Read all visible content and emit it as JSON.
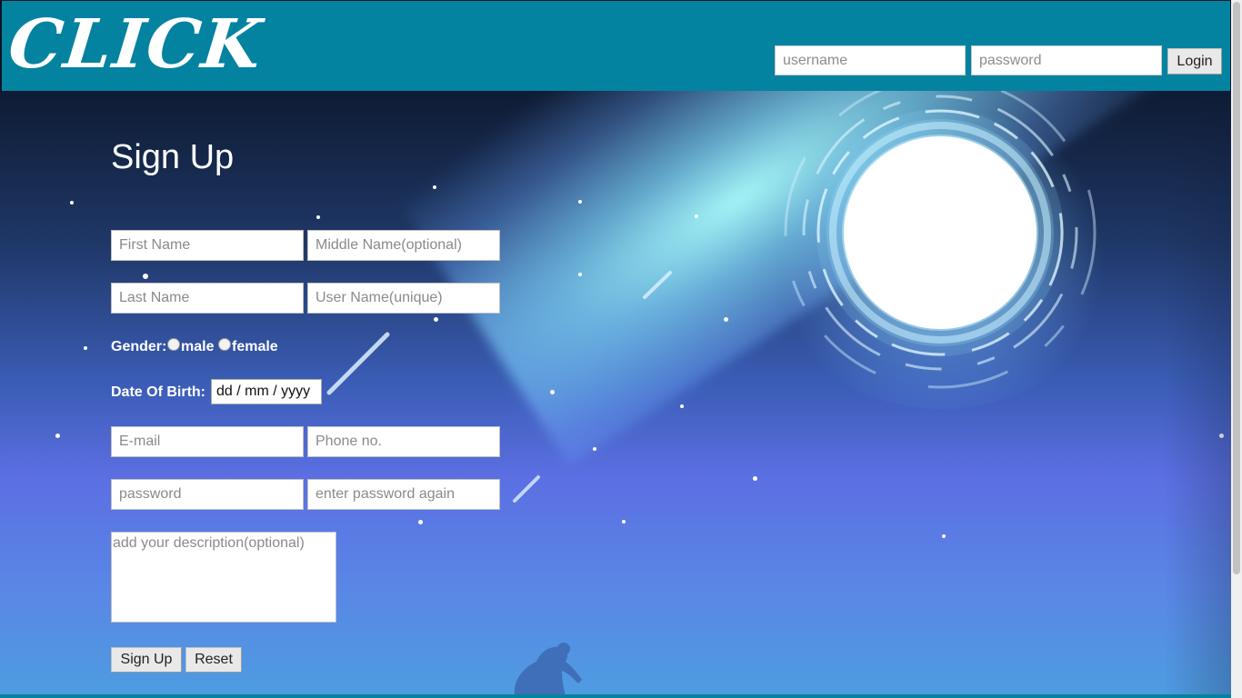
{
  "header": {
    "logo": "CLICK",
    "username_placeholder": "username",
    "password_placeholder": "password",
    "login_label": "Login"
  },
  "form": {
    "title": "Sign Up",
    "first_name_placeholder": "First Name",
    "middle_name_placeholder": "Middle Name(optional)",
    "last_name_placeholder": "Last Name",
    "user_name_placeholder": "User Name(unique)",
    "gender_label": "Gender:",
    "gender_options": [
      "male",
      "female"
    ],
    "dob_label": "Date Of Birth:",
    "dob_value": "dd / mm / yyyy",
    "email_placeholder": "E-mail",
    "phone_placeholder": "Phone no.",
    "password_placeholder": "password",
    "password_again_placeholder": "enter password again",
    "description_placeholder": "add your description(optional)",
    "signup_label": "Sign Up",
    "reset_label": "Reset"
  },
  "colors": {
    "header_bg": "#0383a0",
    "sky_top": "#0e1b33",
    "sky_mid": "#5b6fe2",
    "beam": "#aaffff"
  }
}
